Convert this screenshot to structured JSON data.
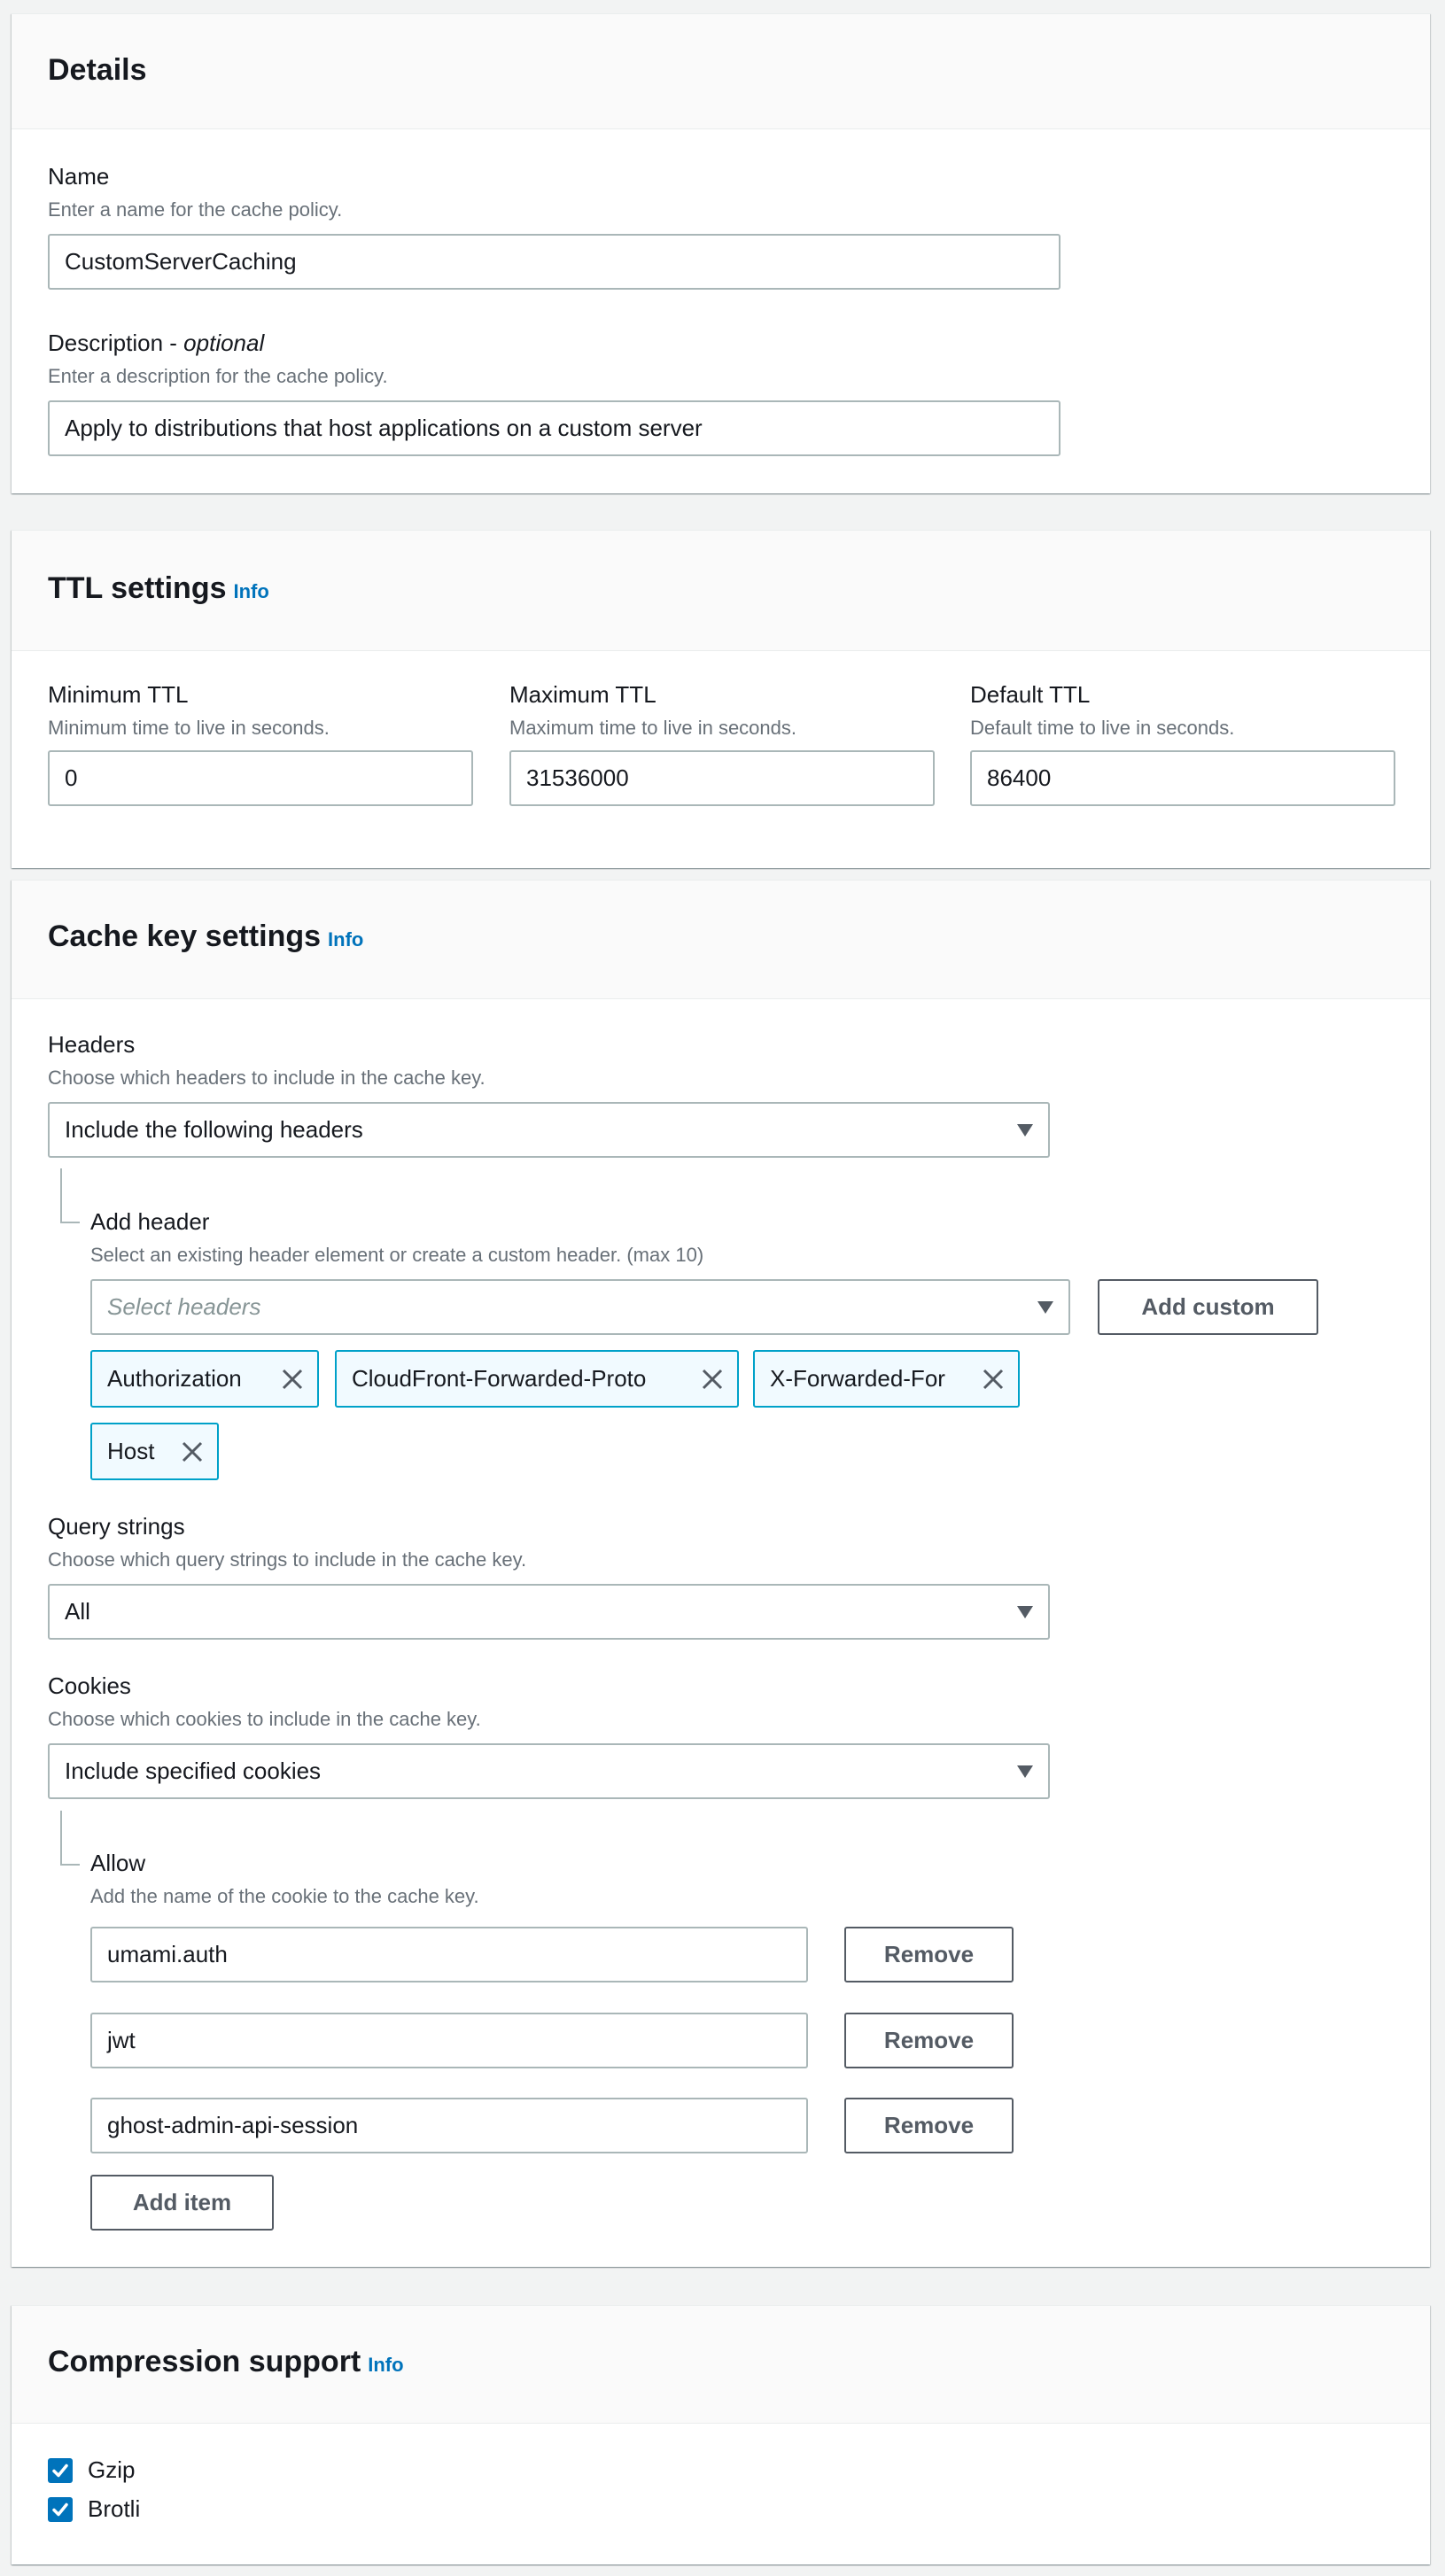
{
  "details": {
    "title": "Details",
    "name": {
      "label": "Name",
      "description": "Enter a name for the cache policy.",
      "value": "CustomServerCaching"
    },
    "description": {
      "label": "Description",
      "label_suffix": " - ",
      "label_optional": "optional",
      "description": "Enter a description for the cache policy.",
      "value": "Apply to distributions that host applications on a custom server"
    }
  },
  "ttl": {
    "title": "TTL settings",
    "info": "Info",
    "fields": [
      {
        "label": "Minimum TTL",
        "description": "Minimum time to live in seconds.",
        "value": "0"
      },
      {
        "label": "Maximum TTL",
        "description": "Maximum time to live in seconds.",
        "value": "31536000"
      },
      {
        "label": "Default TTL",
        "description": "Default time to live in seconds.",
        "value": "86400"
      }
    ]
  },
  "cache_key": {
    "title": "Cache key settings",
    "info": "Info",
    "headers": {
      "label": "Headers",
      "description": "Choose which headers to include in the cache key.",
      "selected": "Include the following headers",
      "add_header": {
        "label": "Add header",
        "description": "Select an existing header element or create a custom header. (max 10)",
        "placeholder": "Select headers",
        "add_custom_label": "Add custom"
      },
      "tokens": [
        "Authorization",
        "CloudFront-Forwarded-Proto",
        "X-Forwarded-For",
        "Host"
      ]
    },
    "query_strings": {
      "label": "Query strings",
      "description": "Choose which query strings to include in the cache key.",
      "selected": "All"
    },
    "cookies": {
      "label": "Cookies",
      "description": "Choose which cookies to include in the cache key.",
      "selected": "Include specified cookies",
      "allow": {
        "label": "Allow",
        "description": "Add the name of the cookie to the cache key.",
        "items": [
          "umami.auth",
          "jwt",
          "ghost-admin-api-session"
        ],
        "remove_label": "Remove",
        "add_item_label": "Add item"
      }
    }
  },
  "compression": {
    "title": "Compression support",
    "info": "Info",
    "options": [
      {
        "label": "Gzip",
        "checked": true
      },
      {
        "label": "Brotli",
        "checked": true
      }
    ]
  },
  "colors": {
    "accent": "#0073bb",
    "token_border": "#00a1c9",
    "token_bg": "#f1faff",
    "page_bg": "#f2f3f3"
  }
}
